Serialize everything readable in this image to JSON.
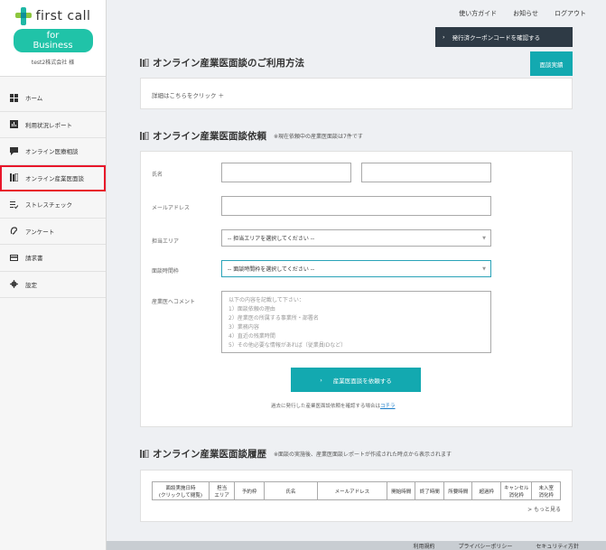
{
  "brand": {
    "logo_text": "first call",
    "pill": "for Business",
    "company": "test2株式会社 様",
    "accent": "#20c3a8"
  },
  "nav": [
    {
      "label": "ホーム",
      "icon": "grid-icon"
    },
    {
      "label": "利用状況レポート",
      "icon": "chart-icon"
    },
    {
      "label": "オンライン医療相談",
      "icon": "chat-icon"
    },
    {
      "label": "オンライン産業医面談",
      "icon": "books-icon"
    },
    {
      "label": "ストレスチェック",
      "icon": "list-check-icon"
    },
    {
      "label": "アンケート",
      "icon": "ear-icon"
    },
    {
      "label": "請求書",
      "icon": "card-icon"
    },
    {
      "label": "設定",
      "icon": "gear-icon"
    }
  ],
  "topbar": {
    "guide": "使い方ガイド",
    "notice": "お知らせ",
    "logout": "ログアウト"
  },
  "coupon_button": "発行済クーポンコードを確認する",
  "usage": {
    "title": "オンライン産業医面談のご利用方法",
    "record_button": "面談実績",
    "details_link": "詳細はこちらをクリック ＋"
  },
  "request": {
    "title": "オンライン産業医面談依頼",
    "subtitle": "※現在依頼中の産業医面談は7件です",
    "name_label": "氏名",
    "email_label": "メールアドレス",
    "area_label": "担当エリア",
    "area_placeholder": "-- 担当エリアを選択してください --",
    "time_label": "面談時間枠",
    "time_placeholder": "-- 面談時間枠を選択してください --",
    "comment_label": "産業医へコメント",
    "comment_placeholder": "以下の内容を記載して下さい：\n1）面談依頼の理由\n2）産業医の所属する事業所・部署名\n3）業務内容\n4）直近の残業時間\n5）その他必要な情報があれば（従業員IDなど）",
    "submit": "産業医面談を依頼する",
    "note": "過去に発行した産業医面談依頼を確認する場合は",
    "note_link": "コチラ"
  },
  "history": {
    "title": "オンライン産業医面談履歴",
    "subtitle": "※面談の実施後、産業医面談レポートが作成された時点から表示されます",
    "columns": [
      "面談実施日時\n(クリックして閲覧)",
      "担当\nエリア",
      "予約枠",
      "氏名",
      "メールアドレス",
      "開始時間",
      "終了時間",
      "所要時間",
      "超過枠",
      "キャンセル\n消化枠",
      "未入室\n消化枠"
    ],
    "more": "> もっと見る"
  },
  "footer": {
    "terms": "利用規約",
    "privacy": "プライバシーポリシー",
    "security": "セキュリティ方針"
  }
}
